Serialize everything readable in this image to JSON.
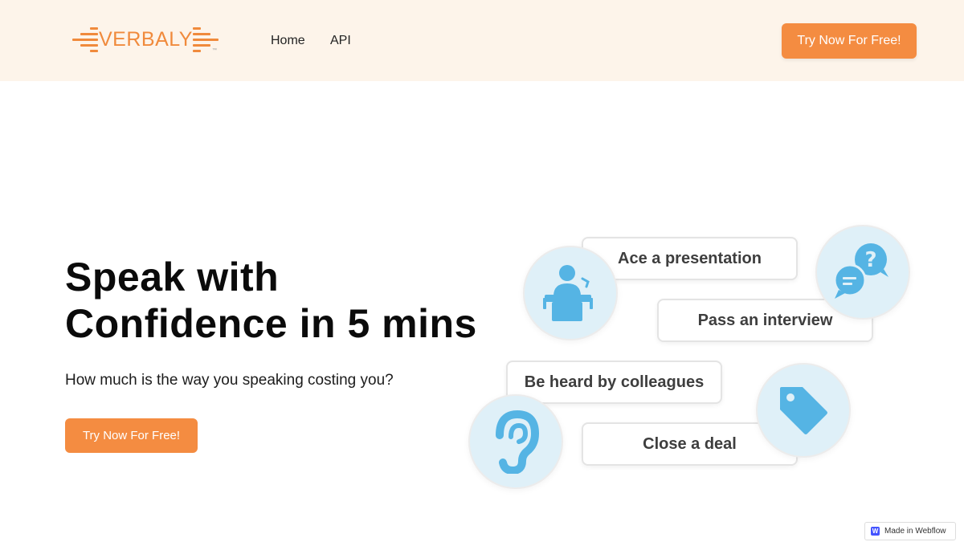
{
  "nav": {
    "logo_text": "VERBALY",
    "logo_tm": "™",
    "links": [
      {
        "label": "Home"
      },
      {
        "label": "API"
      }
    ],
    "cta_label": "Try Now For Free!"
  },
  "hero": {
    "title_line1": "Speak with",
    "title_line2": "Confidence in 5 mins",
    "subtitle": "How much is the way you speaking costing you?",
    "cta_label": "Try Now For Free!"
  },
  "use_cases": [
    {
      "label": "Ace a presentation",
      "icon": "presenter-icon"
    },
    {
      "label": "Pass an interview",
      "icon": "chat-question-icon"
    },
    {
      "label": "Be heard by colleagues",
      "icon": "ear-icon"
    },
    {
      "label": "Close a deal",
      "icon": "price-tag-icon"
    }
  ],
  "badge": {
    "label": "Made in Webflow",
    "logo_letter": "W"
  },
  "colors": {
    "brand_orange": "#f48c41",
    "nav_background": "#fdf4ea",
    "icon_blue": "#55b4e4",
    "circle_background": "#dff0f8"
  }
}
